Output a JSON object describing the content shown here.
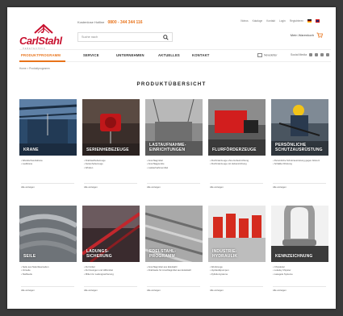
{
  "header": {
    "logo_text": "CarlStahl",
    "logo_sub": "HEBETECHNIK",
    "hotline_label": "Kostenlose Hotline",
    "hotline_number": "0800 - 344 344 116",
    "toplinks": [
      "Videos",
      "Kataloge",
      "Kontakt",
      "Login",
      "Registrieren"
    ],
    "search_placeholder": "Suche nach",
    "basket_label": "Mein Warenkorb"
  },
  "nav": {
    "items": [
      "PRODUKTPROGRAMM",
      "SERVICE",
      "UNTERNEHMEN",
      "AKTUELLES",
      "KONTAKT"
    ],
    "newsletter": "Newsletter",
    "social_label": "Social Media"
  },
  "breadcrumb": [
    "Home",
    ">",
    "Produktprogramm"
  ],
  "page_title": "PRODUKTÜBERSICHT",
  "cards": [
    {
      "title": "KRANE",
      "bullets": [
        "Wandschwenkkrane",
        "Laufkrane"
      ],
      "more": "Alle anzeigen"
    },
    {
      "title": "SERIENHEBEZEUGE",
      "bullets": [
        "Drahtseilhebezeuge",
        "Kettenhebezeuge",
        "Winden"
      ],
      "more": "Alle anzeigen"
    },
    {
      "title": "LASTAUFNAHME-\nEINRICHTUNGEN",
      "bullets": [
        "Anschlagmittel",
        "Anschlagpunkte",
        "Lastaufnahmemittel"
      ],
      "more": "Alle anzeigen"
    },
    {
      "title": "FLURFÖRDERZEUGE",
      "bullets": [
        "Flurförderzeuge ohne Hubeinrichtung",
        "Flurförderzeuge mit Hubeinrichtung"
      ],
      "more": "Alle anzeigen"
    },
    {
      "title": "PERSÖNLICHE\nSCHUTZAUSRÜSTUNG",
      "bullets": [
        "Persönliche Schutzausrüstung gegen Absturz",
        "Schäkler Rüstung"
      ],
      "more": "Alle anzeigen"
    },
    {
      "title": "SEILE",
      "bullets": [
        "Seile aus Naturfaserseilen",
        "Vorseile",
        "Stahlseile"
      ],
      "more": "Alle anzeigen"
    },
    {
      "title": "LADUNGS-\nSICHERUNG",
      "bullets": [
        "Zurrmittel",
        "Zurrösungen und Hilfsmittel",
        "Mittel zur Ladungssicherung"
      ],
      "more": "Alle anzeigen"
    },
    {
      "title": "EDELSTAHL-\nPROGRAMM",
      "bullets": [
        "Anschlagmittel aus Edelstahl",
        "Drahtseile für Anschlagmittel aus Edelstahl"
      ],
      "more": "Alle anzeigen"
    },
    {
      "title": "INDUSTRIE-\nHYDRAULIK",
      "bullets": [
        "Werkzeuge",
        "Hydraulikpumpen",
        "Zylindersysteme"
      ],
      "more": "Alle anzeigen"
    },
    {
      "title": "KENNZEICHNUNG",
      "bullets": [
        "Chipsleiter",
        "Lokalsy Chipster",
        "Lasagole Systeme"
      ],
      "more": "Alle anzeigen"
    }
  ],
  "colors": {
    "accent": "#e8731a",
    "brand_red": "#c8102e"
  }
}
